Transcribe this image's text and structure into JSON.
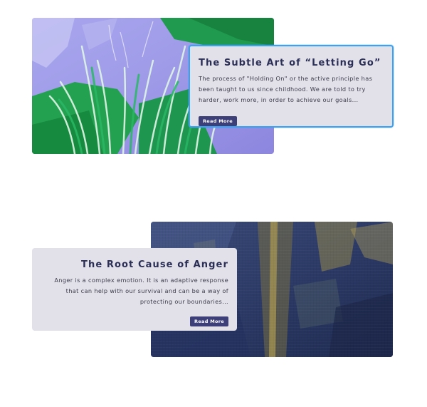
{
  "posts": [
    {
      "title": "The Subtle Art of “Letting Go”",
      "excerpt": "The process of \"Holding On\" or the active principle has been taught to us since childhood. We are told to try harder, work more, in order to achieve our goals...",
      "button_label": "Read More",
      "image": "green-violet-abstract-painting"
    },
    {
      "title": "The Root Cause of Anger",
      "excerpt": "Anger is a complex emotion. It is an adaptive response that can help with our survival and can be a way of protecting our boundaries...",
      "button_label": "Read More",
      "image": "navy-gold-canvas-painting"
    }
  ],
  "colors": {
    "card_background": "#e2e1ea",
    "active_border": "#3ba1f2",
    "title": "#2b2f55",
    "button": "#3d3f79"
  }
}
